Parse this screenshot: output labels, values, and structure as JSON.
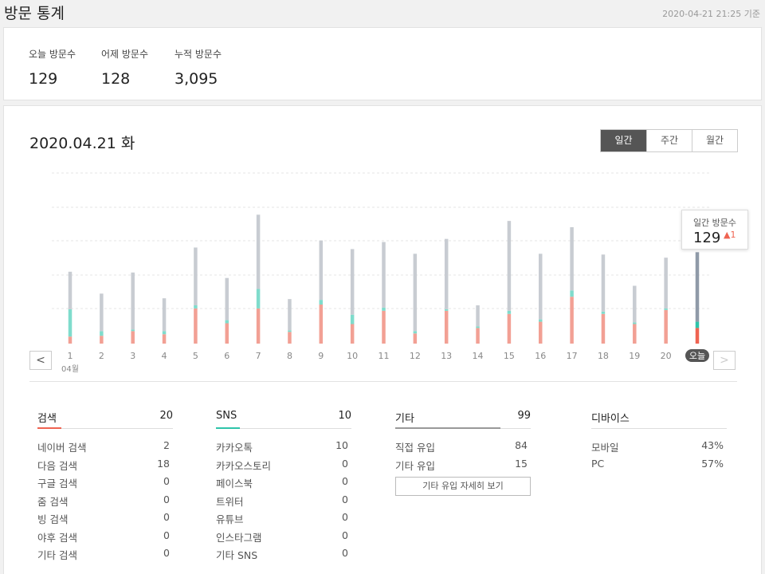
{
  "header": {
    "title": "방문 통계",
    "updated": "2020-04-21 21:25 기준"
  },
  "summary": [
    {
      "label": "오늘 방문수",
      "value": "129"
    },
    {
      "label": "어제 방문수",
      "value": "128"
    },
    {
      "label": "누적 방문수",
      "value": "3,095"
    }
  ],
  "chart_panel": {
    "date": "2020.04.21 화",
    "tabs": [
      {
        "label": "일간",
        "active": true
      },
      {
        "label": "주간",
        "active": false
      },
      {
        "label": "월간",
        "active": false
      }
    ],
    "prev_label": "<",
    "next_label": ">",
    "tooltip": {
      "label": "일간 방문수",
      "value": "129",
      "delta": "1"
    }
  },
  "chart_data": {
    "type": "bar",
    "stacked": true,
    "categories": [
      "1",
      "2",
      "3",
      "4",
      "5",
      "6",
      "7",
      "8",
      "9",
      "10",
      "11",
      "12",
      "13",
      "14",
      "15",
      "16",
      "17",
      "18",
      "19",
      "20",
      "오늘"
    ],
    "month_label": "04월",
    "series": [
      {
        "color": "#f2a094",
        "values": [
          9,
          10,
          16,
          12,
          45,
          26,
          45,
          15,
          50,
          25,
          42,
          13,
          42,
          20,
          38,
          28,
          60,
          38,
          25,
          43,
          20
        ]
      },
      {
        "color": "#7fdccc",
        "values": [
          35,
          6,
          2,
          4,
          4,
          4,
          25,
          2,
          6,
          12,
          4,
          3,
          2,
          2,
          4,
          3,
          8,
          3,
          2,
          2,
          8
        ]
      },
      {
        "color": "#c8ccd2",
        "values": [
          48,
          48,
          73,
          42,
          74,
          54,
          95,
          40,
          76,
          84,
          84,
          99,
          90,
          27,
          115,
          84,
          81,
          73,
          47,
          65,
          89
        ]
      }
    ],
    "highlight_colors": {
      "bottom": "#ef6351",
      "middle": "#2ec4aa",
      "top": "#8f9aa8"
    },
    "gridlines": true,
    "highlight_index": 20
  },
  "sources": [
    {
      "title": "검색",
      "total": "20",
      "accent": "#ef6351",
      "rows": [
        {
          "name": "네이버 검색",
          "value": "2"
        },
        {
          "name": "다음 검색",
          "value": "18"
        },
        {
          "name": "구글 검색",
          "value": "0"
        },
        {
          "name": "줌 검색",
          "value": "0"
        },
        {
          "name": "빙 검색",
          "value": "0"
        },
        {
          "name": "야후 검색",
          "value": "0"
        },
        {
          "name": "기타 검색",
          "value": "0"
        }
      ]
    },
    {
      "title": "SNS",
      "total": "10",
      "accent": "#2ec4aa",
      "rows": [
        {
          "name": "카카오톡",
          "value": "10"
        },
        {
          "name": "카카오스토리",
          "value": "0"
        },
        {
          "name": "페이스북",
          "value": "0"
        },
        {
          "name": "트위터",
          "value": "0"
        },
        {
          "name": "유튜브",
          "value": "0"
        },
        {
          "name": "인스타그램",
          "value": "0"
        },
        {
          "name": "기타 SNS",
          "value": "0"
        }
      ]
    },
    {
      "title": "기타",
      "total": "99",
      "accent": "#999999",
      "rows": [
        {
          "name": "직접 유입",
          "value": "84"
        },
        {
          "name": "기타 유입",
          "value": "15"
        }
      ],
      "button": "기타 유입 자세히 보기"
    },
    {
      "title": "디바이스",
      "total": "",
      "accent": "",
      "rows": [
        {
          "name": "모바일",
          "value": "43%"
        },
        {
          "name": "PC",
          "value": "57%"
        }
      ]
    }
  ]
}
